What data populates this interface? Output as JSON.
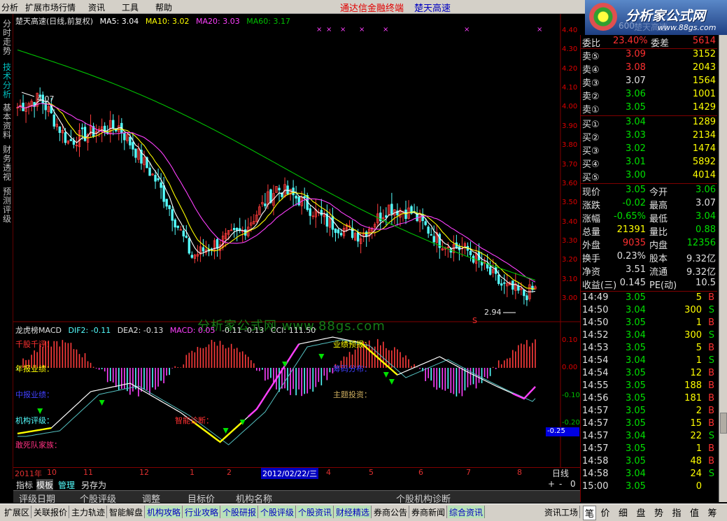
{
  "menu": {
    "items": [
      "分析",
      "扩展市场行情",
      "资讯",
      "工具",
      "帮助"
    ],
    "brand": "通达信金融终端",
    "stock_title": "楚天高速"
  },
  "logo": {
    "title": "分析家公式网",
    "url": "www.88gs.com",
    "ghost": "楚天高速",
    "ghost_prefix": "600"
  },
  "left_tabs": [
    {
      "label": "分时走势",
      "active": false
    },
    {
      "label": "技术分析",
      "active": true
    },
    {
      "label": "基本资料",
      "active": false
    },
    {
      "label": "财务透视",
      "active": false
    },
    {
      "label": "预测评级",
      "active": false
    }
  ],
  "chart_header": {
    "title": "楚天高速(日线,前复权)",
    "ma5": "MA5: 3.04",
    "ma10": "MA10: 3.02",
    "ma20": "MA20: 3.03",
    "ma60": "MA60: 3.17",
    "high_mark": "4.07",
    "low_mark": "2.94"
  },
  "watermark": {
    "text": "分析家公式网 www.88gs.com"
  },
  "indicator_header": {
    "name": "龙虎榜MACD",
    "dif": "DIF2: -0.11",
    "dea": "DEA2: -0.13",
    "macd": "MACD: 0.05",
    "extra": "-0.11  -0.13",
    "cci": "CCI: 111.50"
  },
  "indicator_labels": {
    "qianguqianping": "千股千评：",
    "nianbao": "年报业绩：",
    "zhongbao": "中报业绩：",
    "jigou": "机构评级：",
    "gansi": "敢死队家族：",
    "yeji": "业绩预报：",
    "zhineng": "智能诊断：",
    "fenhong": "主题投资：",
    "chips": "筹码分布："
  },
  "price_axis": [
    "4.40",
    "4.30",
    "4.20",
    "4.10",
    "4.00",
    "3.90",
    "3.80",
    "3.70",
    "3.60",
    "3.50",
    "3.40",
    "3.30",
    "3.20",
    "3.10",
    "3.00"
  ],
  "macd_axis": [
    "0.10",
    "0.00",
    "-0.10",
    "-0.20",
    "-0.25"
  ],
  "date_axis": {
    "labels": [
      "2011年",
      "10",
      "11",
      "12",
      "1",
      "2",
      "4",
      "5",
      "6",
      "7",
      "8"
    ],
    "cursor_date": "2012/02/22/三",
    "period": "日线"
  },
  "bottom_tabs": {
    "items": [
      "指标",
      "模板",
      "管理",
      "另存为"
    ],
    "selected": "模板",
    "zoom": [
      "+",
      "-",
      "0"
    ]
  },
  "pool_tabs": [
    "评级日期",
    "个股评级",
    "调整",
    "目标价",
    "机构名称",
    "个股机构诊断"
  ],
  "status_tabs": [
    {
      "label": "扩展区",
      "hl": false
    },
    {
      "label": "关联报价",
      "hl": false
    },
    {
      "label": "主力轨迹",
      "hl": false
    },
    {
      "label": "智能解盘",
      "hl": false
    },
    {
      "label": "机构攻略",
      "hl": true
    },
    {
      "label": "行业攻略",
      "hl": true
    },
    {
      "label": "个股研报",
      "hl": true
    },
    {
      "label": "个股评级",
      "hl": true
    },
    {
      "label": "个股资讯",
      "hl": true
    },
    {
      "label": "财经精选",
      "hl": true
    },
    {
      "label": "券商公告",
      "hl": false
    },
    {
      "label": "券商新闻",
      "hl": false
    },
    {
      "label": "综合资讯",
      "hl": true
    },
    {
      "label": "资讯工场",
      "hl": false
    }
  ],
  "right_tabs": {
    "items": [
      "笔",
      "价",
      "细",
      "盘",
      "势",
      "指",
      "值",
      "筹"
    ],
    "selected": "笔"
  },
  "quote": {
    "weibi": {
      "label": "委比",
      "value": "23.40%",
      "label2": "委差",
      "value2": "5614"
    },
    "asks": [
      {
        "label": "卖⑤",
        "price": "3.09",
        "vol": "3152",
        "pc": "red"
      },
      {
        "label": "卖④",
        "price": "3.08",
        "vol": "2043",
        "pc": "red"
      },
      {
        "label": "卖③",
        "price": "3.07",
        "vol": "1564",
        "pc": "white"
      },
      {
        "label": "卖②",
        "price": "3.06",
        "vol": "1001",
        "pc": "green"
      },
      {
        "label": "卖①",
        "price": "3.05",
        "vol": "1429",
        "pc": "green"
      }
    ],
    "bids": [
      {
        "label": "买①",
        "price": "3.04",
        "vol": "1289",
        "pc": "green"
      },
      {
        "label": "买②",
        "price": "3.03",
        "vol": "2134",
        "pc": "green"
      },
      {
        "label": "买③",
        "price": "3.02",
        "vol": "1474",
        "pc": "green"
      },
      {
        "label": "买④",
        "price": "3.01",
        "vol": "5892",
        "pc": "green"
      },
      {
        "label": "买⑤",
        "price": "3.00",
        "vol": "4014",
        "pc": "green"
      }
    ],
    "stats": [
      {
        "l1": "现价",
        "v1": "3.05",
        "c1": "green",
        "l2": "今开",
        "v2": "3.06",
        "c2": "green"
      },
      {
        "l1": "涨跌",
        "v1": "-0.02",
        "c1": "green",
        "l2": "最高",
        "v2": "3.07",
        "c2": "white"
      },
      {
        "l1": "涨幅",
        "v1": "-0.65%",
        "c1": "green",
        "l2": "最低",
        "v2": "3.04",
        "c2": "green"
      },
      {
        "l1": "总量",
        "v1": "21391",
        "c1": "yellow",
        "l2": "量比",
        "v2": "0.88",
        "c2": "green"
      },
      {
        "l1": "外盘",
        "v1": "9035",
        "c1": "red",
        "l2": "内盘",
        "v2": "12356",
        "c2": "green"
      },
      {
        "l1": "换手",
        "v1": "0.23%",
        "c1": "white",
        "l2": "股本",
        "v2": "9.32亿",
        "c2": "white"
      },
      {
        "l1": "净资",
        "v1": "3.51",
        "c1": "white",
        "l2": "流通",
        "v2": "9.32亿",
        "c2": "white"
      },
      {
        "l1": "收益(三)",
        "v1": "0.145",
        "c1": "white",
        "l2": "PE(动)",
        "v2": "10.5",
        "c2": "white"
      }
    ],
    "ticks": [
      {
        "time": "14:49",
        "price": "3.05",
        "vol": "5",
        "bs": "B"
      },
      {
        "time": "14:50",
        "price": "3.04",
        "vol": "300",
        "bs": "S"
      },
      {
        "time": "14:50",
        "price": "3.05",
        "vol": "1",
        "bs": "B"
      },
      {
        "time": "14:52",
        "price": "3.04",
        "vol": "300",
        "bs": "S"
      },
      {
        "time": "14:53",
        "price": "3.05",
        "vol": "5",
        "bs": "B"
      },
      {
        "time": "14:54",
        "price": "3.04",
        "vol": "1",
        "bs": "S"
      },
      {
        "time": "14:54",
        "price": "3.05",
        "vol": "12",
        "bs": "B"
      },
      {
        "time": "14:55",
        "price": "3.05",
        "vol": "188",
        "bs": "B"
      },
      {
        "time": "14:56",
        "price": "3.05",
        "vol": "181",
        "bs": "B"
      },
      {
        "time": "14:57",
        "price": "3.05",
        "vol": "2",
        "bs": "B"
      },
      {
        "time": "14:57",
        "price": "3.05",
        "vol": "15",
        "bs": "B"
      },
      {
        "time": "14:57",
        "price": "3.04",
        "vol": "22",
        "bs": "S"
      },
      {
        "time": "14:57",
        "price": "3.05",
        "vol": "1",
        "bs": "B"
      },
      {
        "time": "14:58",
        "price": "3.05",
        "vol": "48",
        "bs": "B"
      },
      {
        "time": "14:58",
        "price": "3.04",
        "vol": "24",
        "bs": "S"
      },
      {
        "time": "15:00",
        "price": "3.05",
        "vol": "0",
        "bs": ""
      }
    ]
  },
  "colors": {
    "up": "#ff3c3c",
    "down": "#54ffff",
    "ma5": "#ffffff",
    "ma10": "#ffff00",
    "ma20": "#ff40ff",
    "ma60": "#00c000",
    "red": "#ff3030",
    "green": "#00e000",
    "yellow": "#ffff00"
  }
}
